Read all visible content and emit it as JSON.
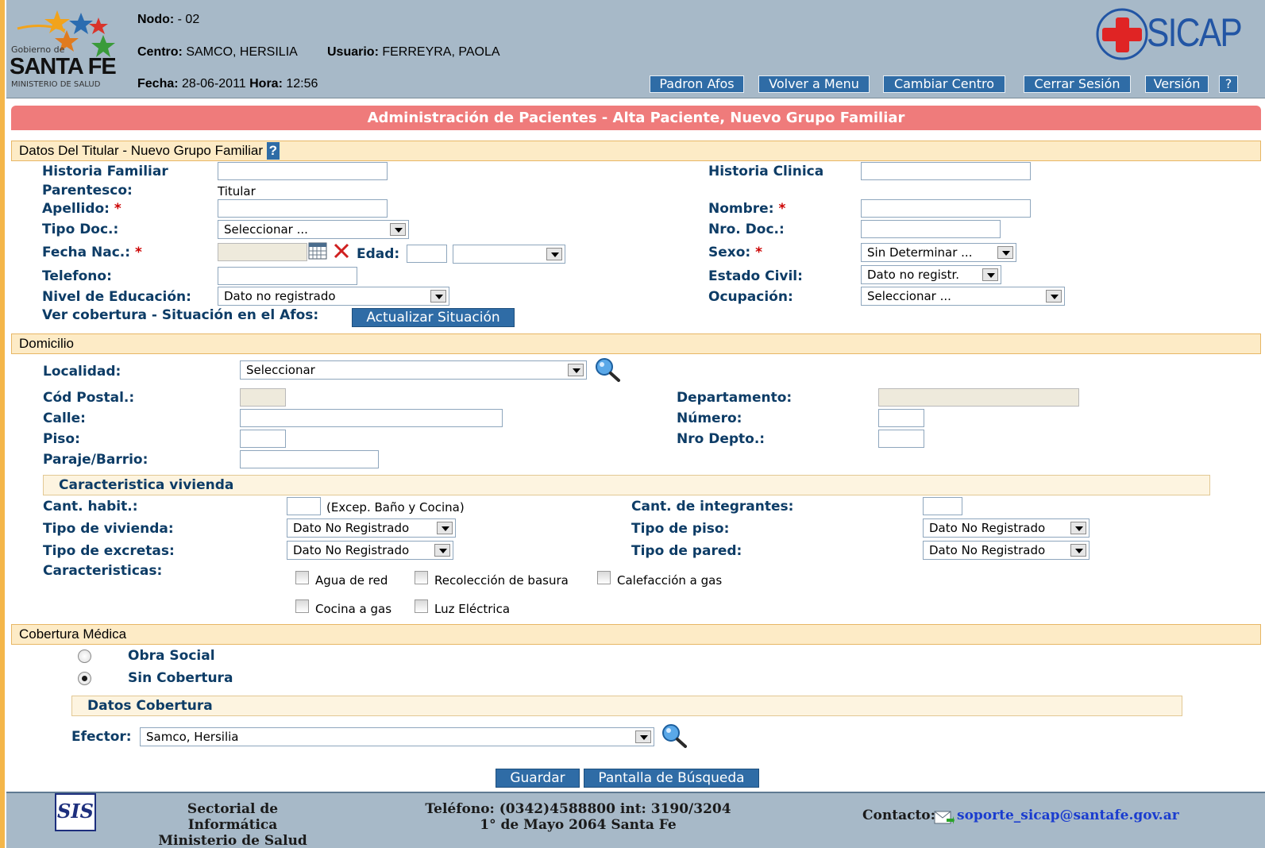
{
  "header": {
    "logo": {
      "line1": "Gobierno de",
      "line2": "SANTA FE",
      "line3": "MINISTERIO DE SALUD"
    },
    "brand": "SICAP",
    "nodo_label": "Nodo:",
    "nodo_value": " - 02",
    "centro_label": "Centro:",
    "centro_value": " SAMCO, HERSILIA",
    "usuario_label": "Usuario:",
    "usuario_value": " FERREYRA, PAOLA",
    "fecha_label": "Fecha:",
    "fecha_value": " 28-06-2011 ",
    "hora_label": "Hora:",
    "hora_value": " 12:56",
    "buttons": [
      "Padron Afos",
      "Volver a Menu",
      "Cambiar Centro",
      "Cerrar Sesión",
      "Versión",
      "?"
    ]
  },
  "title": "Administración de Pacientes - Alta Paciente, Nuevo Grupo Familiar",
  "titular": {
    "section": "Datos Del Titular - Nuevo Grupo Familiar",
    "help": "?",
    "historia_familiar": "Historia Familiar",
    "historia_clinica": "Historia Clinica",
    "parentesco": "Parentesco:",
    "parentesco_value": "Titular",
    "apellido": "Apellido:",
    "nombre": "Nombre:",
    "required": "*",
    "tipo_doc": "Tipo Doc.:",
    "tipo_doc_value": "Seleccionar ...",
    "nro_doc": "Nro. Doc.:",
    "fecha_nac": "Fecha Nac.:",
    "edad": "Edad:",
    "sexo": "Sexo:",
    "sexo_value": "Sin Determinar ...",
    "telefono": "Telefono:",
    "estado_civil": "Estado Civil:",
    "estado_civil_value": "Dato no registr.",
    "nivel_educacion": "Nivel de Educación:",
    "nivel_educacion_value": "Dato no registrado",
    "ocupacion": "Ocupación:",
    "ocupacion_value": "Seleccionar ...",
    "ver_cobertura": "Ver cobertura - Situación en el Afos:",
    "actualizar": "Actualizar Situación"
  },
  "domicilio": {
    "section": "Domicilio",
    "localidad": "Localidad:",
    "localidad_value": "Seleccionar",
    "cod_postal": "Cód Postal.:",
    "departamento": "Departamento:",
    "calle": "Calle:",
    "numero": "Número:",
    "piso": "Piso:",
    "nro_depto": "Nro Depto.:",
    "paraje": "Paraje/Barrio:",
    "vivienda_section": "Caracteristica vivienda",
    "cant_habit": "Cant. habit.:",
    "cant_habit_note": "(Excep. Baño y Cocina)",
    "cant_integrantes": "Cant. de integrantes:",
    "tipo_vivienda": "Tipo de vivienda:",
    "tipo_vivienda_value": "Dato No Registrado",
    "tipo_piso": "Tipo de piso:",
    "tipo_piso_value": "Dato No Registrado",
    "tipo_excretas": "Tipo de excretas:",
    "tipo_excretas_value": "Dato No Registrado",
    "tipo_pared": "Tipo de pared:",
    "tipo_pared_value": "Dato No Registrado",
    "caracteristicas": "Caracteristicas:",
    "checks": [
      "Agua de red",
      "Recolección de basura",
      "Calefacción a gas",
      "Cocina a gas",
      "Luz Eléctrica"
    ]
  },
  "cobertura": {
    "section": "Cobertura Médica",
    "obra_social": "Obra Social",
    "sin_cobertura": "Sin Cobertura",
    "selected": "Sin Cobertura",
    "datos_section": "Datos Cobertura",
    "efector": "Efector:",
    "efector_value": "Samco, Hersilia"
  },
  "actions": {
    "guardar": "Guardar",
    "busqueda": "Pantalla de Búsqueda"
  },
  "footer": {
    "logo": "SIS",
    "sectorial_1": "Sectorial de Informática",
    "sectorial_2": "Ministerio de Salud",
    "telefono_1": "Teléfono: (0342)4588800 int: 3190/3204",
    "telefono_2": "1° de Mayo 2064 Santa Fe",
    "contacto_label": "Contacto:",
    "email": "soporte_sicap@santafe.gov.ar"
  }
}
